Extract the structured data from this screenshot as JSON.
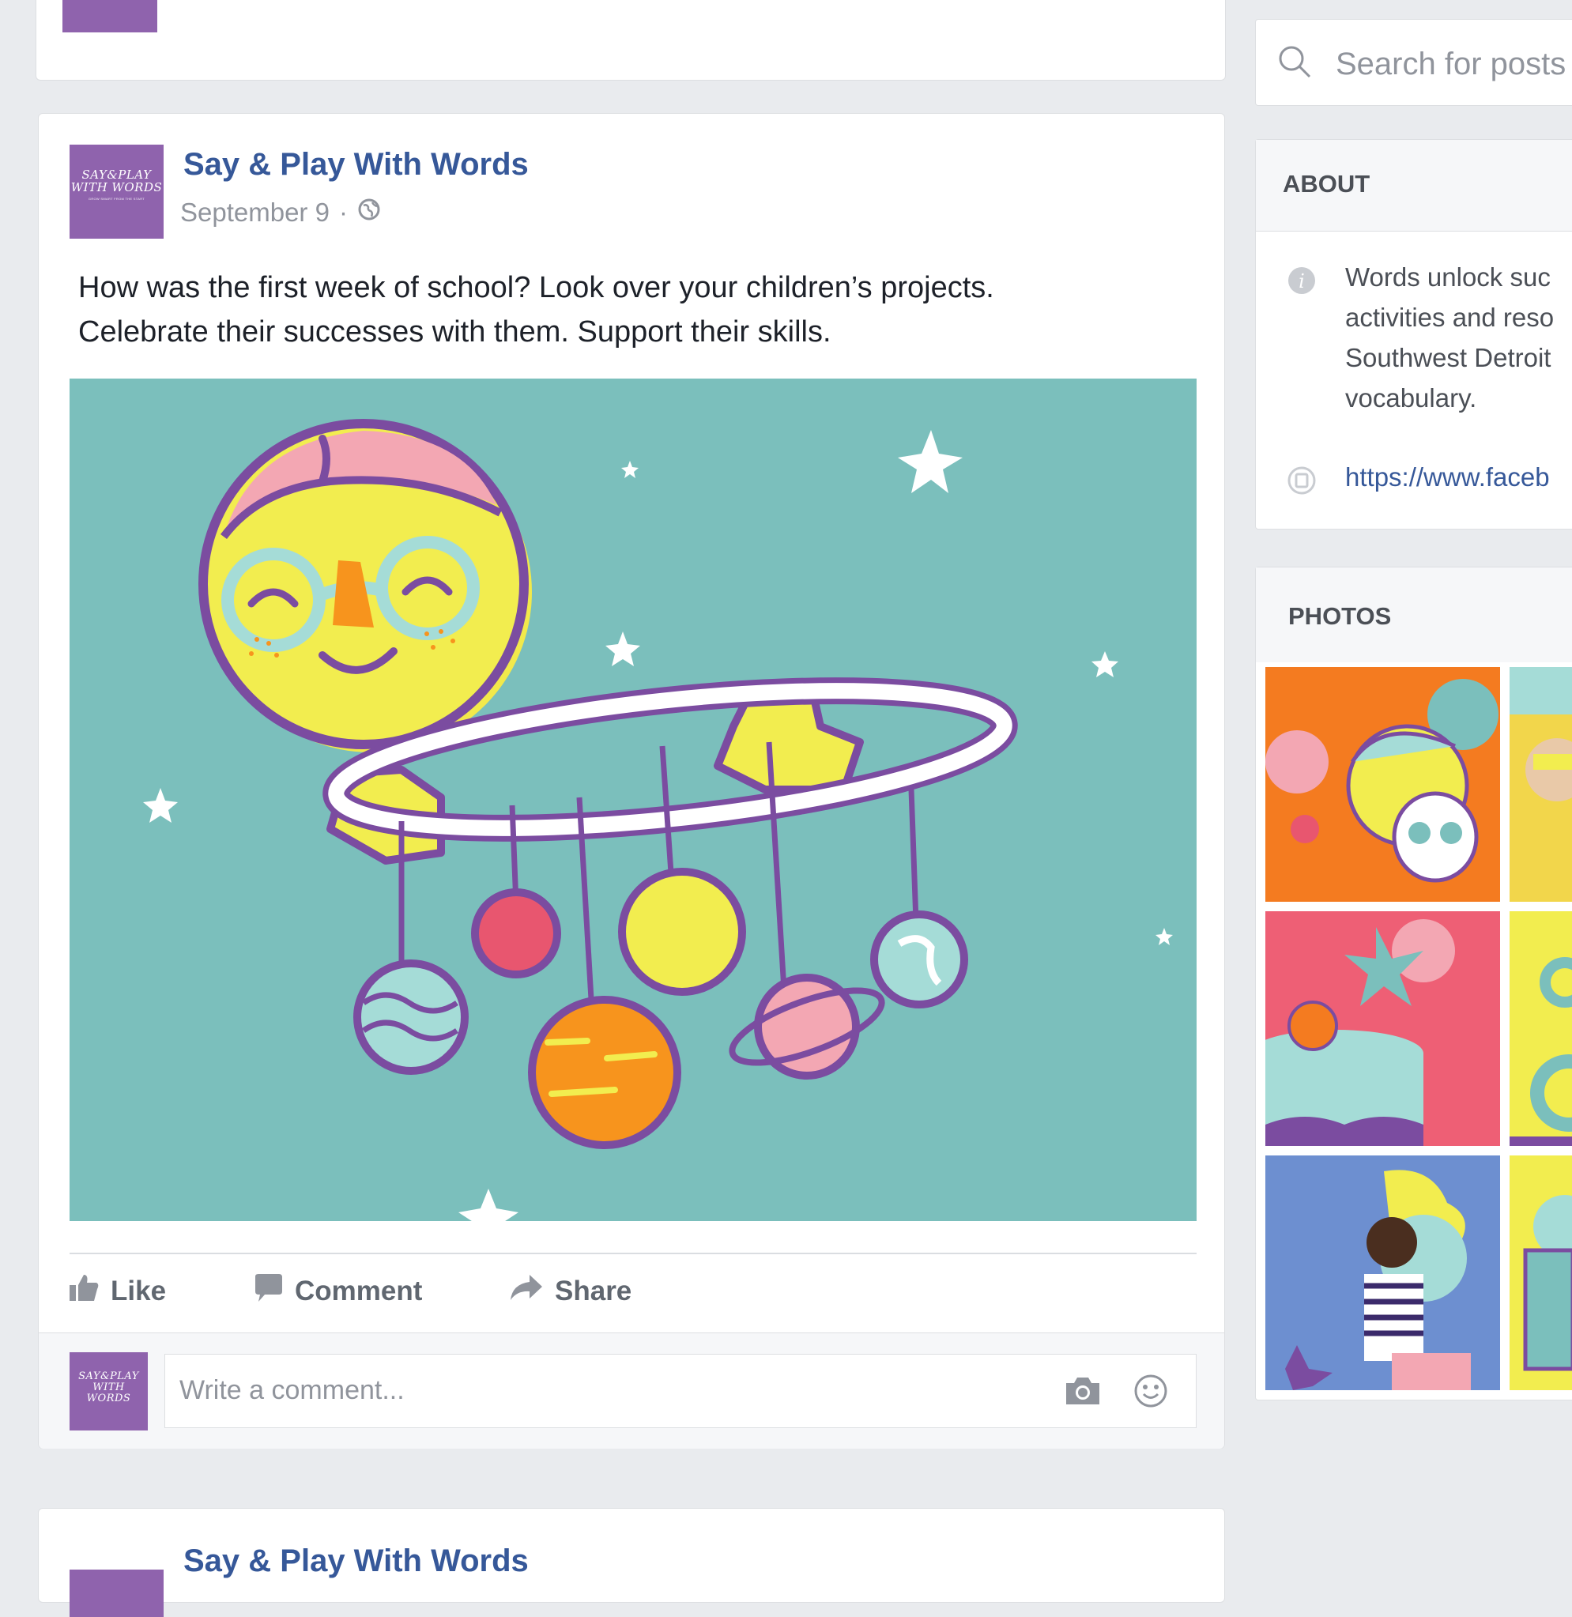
{
  "page": {
    "name": "Say & Play With Words",
    "avatar_line1": "SAY&PLAY",
    "avatar_line2": "WITH WORDS",
    "avatar_tagline": "GROW SMART FROM THE START"
  },
  "post": {
    "date": "September 9",
    "separator": "·",
    "text_line1": "How was the first week of school? Look over your children’s projects.",
    "text_line2": "Celebrate their successes with them. Support their skills.",
    "actions": {
      "like": "Like",
      "comment": "Comment",
      "share": "Share"
    },
    "comment_placeholder": "Write a comment..."
  },
  "next_post": {
    "name": "Say & Play With Words"
  },
  "sidebar": {
    "search_placeholder": "Search for posts",
    "about": {
      "heading": "ABOUT",
      "description_lines": [
        "Words unlock suc",
        "activities and reso",
        "Southwest Detroit",
        "vocabulary."
      ],
      "link": "https://www.faceb"
    },
    "photos": {
      "heading": "PHOTOS"
    }
  },
  "colors": {
    "brand_purple": "#8f63ad",
    "link_blue": "#365899",
    "illustration_teal": "#7bbfbc",
    "page_bg": "#e9ebee"
  },
  "icons": [
    "globe-icon",
    "like-icon",
    "comment-icon",
    "share-icon",
    "camera-icon",
    "emoji-icon",
    "search-icon",
    "info-icon",
    "link-icon"
  ]
}
